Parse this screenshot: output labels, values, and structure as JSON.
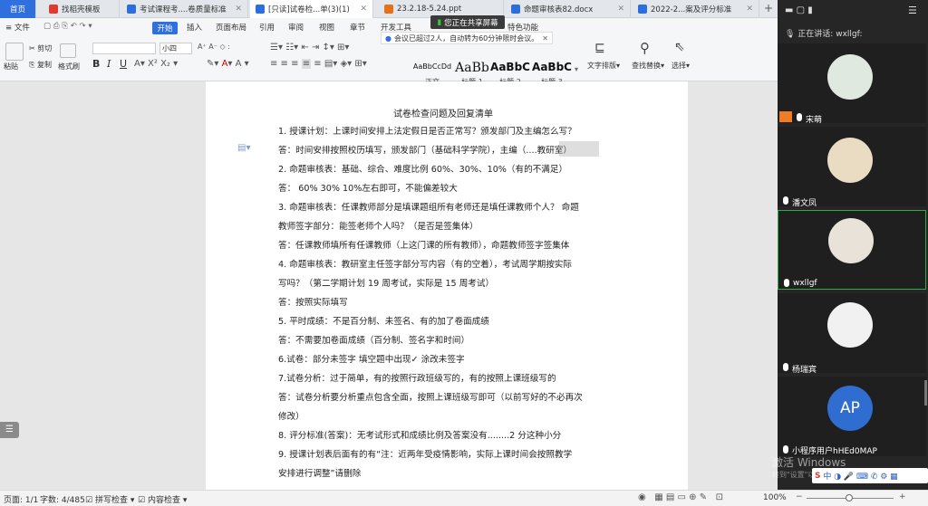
{
  "tabs": [
    {
      "label": "首页",
      "color": "#2f6fde"
    },
    {
      "label": "找稻壳模板",
      "color": "#e03a2f"
    },
    {
      "label": "考试课程考....卷质量标准",
      "color": "#2b6ee0"
    },
    {
      "label": "[只读]试卷检...单(3)(1)",
      "color": "#2b6ee0"
    },
    {
      "label": "23.2.18-5.24.ppt",
      "color": "#e86f1a"
    },
    {
      "label": "命题审核表82.docx",
      "color": "#2b6ee0"
    },
    {
      "label": "2022-2...案及评分标准",
      "color": "#2b6ee0"
    }
  ],
  "ribbon": {
    "file": "文件",
    "start": "开始",
    "menus": [
      "插入",
      "页面布局",
      "引用",
      "审阅",
      "视图",
      "章节",
      "开发工具",
      "特色功能"
    ],
    "cut": "剪切",
    "copy": "复制",
    "paste": "粘贴",
    "format_painter": "格式刷",
    "font_size": "小四",
    "styles": [
      {
        "sample": "AaBbCcDd",
        "label": "正文"
      },
      {
        "sample": "AaBb",
        "label": "标题 1"
      },
      {
        "sample": "AaBbC",
        "label": "标题 2"
      },
      {
        "sample": "AaBbC",
        "label": "标题 3"
      }
    ],
    "text_layout": "文字排版",
    "find_replace": "查找替换",
    "select": "选择"
  },
  "banner": "您正在共享屏幕",
  "notice": "会议已超过2人，自动转为60分钟限时会议。",
  "document": {
    "title": "试卷检查问题及回复清单",
    "lines": [
      "1. 授课计划：上课时间安排上法定假日是否正常写？颁发部门及主编怎么写？",
      "答：时间安排按照校历填写，颁发部门（基础科学学院），主编（....教研室）",
      "2. 命题审核表：基础、综合、难度比例 60%、30%、10%（有的不满足）",
      "答：  60%    30%    10%左右即可，不能偏差较大",
      "3. 命题审核表：任课教师部分是填课题组所有老师还是填任课教师个人？  命题",
      "教师签字部分：能签老师个人吗？（是否是签集体）",
      "答：任课教师填所有任课教师（上这门课的所有教师），命题教师签字签集体",
      "4. 命题审核表：教研室主任签字部分写内容（有的空着），考试周学期按实际",
      "写吗？（第二学期计划 19 周考试，实际是 15 周考试）",
      "答：按照实际填写",
      "5.  平时成绩：不是百分制、未签名、有的加了卷面成绩",
      "答：不需要加卷面成绩（百分制、签名字和时间）",
      "6.试卷：部分未签字  填空题中出现✓  涂改未签字",
      "7.试卷分析：过于简单，有的按照行政班级写的，有的按照上课班级写的",
      "答：试卷分析要分析重点包含全面，按照上课班级写即可（以前写好的不必再次",
      "修改）",
      "8.  评分标准(答案)：无考试形式和成绩比例及答案没有........2 分这种小分",
      "9.  授课计划表后面有的有“注：近两年受疫情影响，实际上课时间会按照教学",
      "安排进行调整”请删除"
    ]
  },
  "status": {
    "page": "页面: 1/1",
    "words": "字数: 4/485",
    "spell": "拼写检查",
    "content": "内容检查",
    "zoom": "100%"
  },
  "meeting": {
    "speaking_label": "正在讲话:",
    "speaking_name": "wxllgf:",
    "participants": [
      {
        "name": "宋萌",
        "bg": "#dfe9df"
      },
      {
        "name": "潘文凤",
        "bg": "#e9dcc3"
      },
      {
        "name": "wxllgf",
        "bg": "#e9e2d8"
      },
      {
        "name": "杨瑞宾",
        "bg": "#f1f1f1"
      },
      {
        "name": "小程序用户hHEd0MAP",
        "initials": "AP",
        "bg": "#2f6ed0"
      }
    ]
  },
  "watermark": {
    "line1": "激活 Windows",
    "line2": "转到\"设置\"以激活 Windows。"
  }
}
